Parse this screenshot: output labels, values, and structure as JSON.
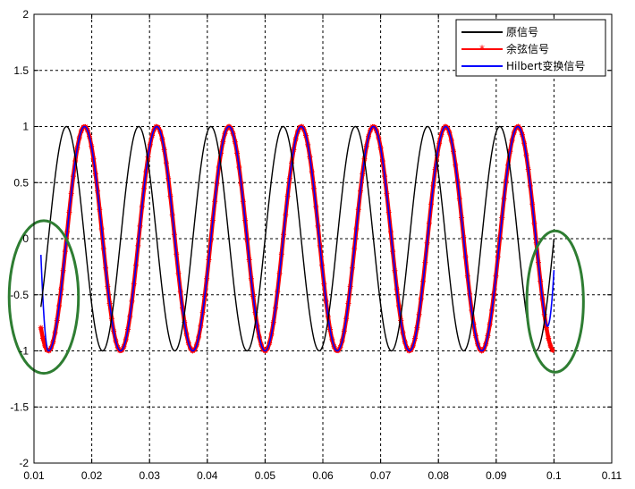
{
  "chart_data": {
    "type": "line",
    "xlim": [
      0.01,
      0.11
    ],
    "ylim": [
      -2,
      2
    ],
    "xticks": [
      0.01,
      0.02,
      0.03,
      0.04,
      0.05,
      0.06,
      0.07,
      0.08,
      0.09,
      0.1,
      0.11
    ],
    "xtick_labels": [
      "0.01",
      "0.02",
      "0.03",
      "0.04",
      "0.05",
      "0.06",
      "0.07",
      "0.08",
      "0.09",
      "0.1",
      "0.11"
    ],
    "yticks": [
      -2,
      -1.5,
      -1,
      -0.5,
      0,
      0.5,
      1,
      1.5,
      2
    ],
    "ytick_labels": [
      "-2",
      "-1.5",
      "-1",
      "-0.5",
      "0",
      "0.5",
      "1",
      "1.5",
      "2"
    ],
    "grid": true,
    "legend_position": "top-right",
    "series": [
      {
        "name": "原信号",
        "function": "sin",
        "frequency_hz": 80,
        "x_range": [
          0.0112,
          0.1
        ],
        "color": "#000000",
        "marker": "none"
      },
      {
        "name": "余弦信号",
        "function": "-cos",
        "frequency_hz": 80,
        "x_range": [
          0.0112,
          0.1
        ],
        "color": "#ff0000",
        "marker": "star"
      },
      {
        "name": "Hilbert变换信号",
        "function": "-cos (edge deviation)",
        "frequency_hz": 80,
        "x_range": [
          0.0112,
          0.1
        ],
        "color": "#0000ff",
        "marker": "none"
      }
    ],
    "annotations": [
      {
        "shape": "ellipse",
        "color": "#2e7d32",
        "center": [
          0.0117,
          -0.52
        ],
        "radius": [
          0.006,
          0.68
        ]
      },
      {
        "shape": "ellipse",
        "color": "#2e7d32",
        "center": [
          0.1002,
          -0.56
        ],
        "radius": [
          0.0049,
          0.63
        ]
      }
    ]
  }
}
